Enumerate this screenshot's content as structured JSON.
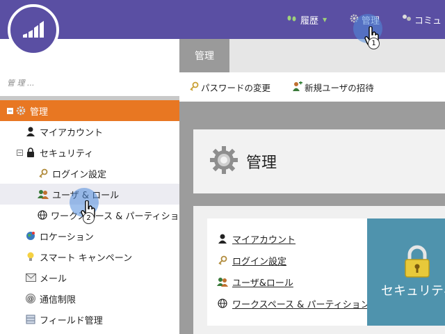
{
  "topbar": {
    "nav": [
      {
        "label": "履歴",
        "icon": "history-icon"
      },
      {
        "label": "管理",
        "icon": "gear-icon"
      },
      {
        "label": "コミュ",
        "icon": "community-icon"
      }
    ]
  },
  "sidebar": {
    "search_placeholder": "管 理 ...",
    "items": [
      {
        "label": "管理",
        "icon": "gear-icon"
      },
      {
        "label": "マイアカウント",
        "icon": "person-icon"
      },
      {
        "label": "セキュリティ",
        "icon": "lock-icon"
      },
      {
        "label": "ログイン設定",
        "icon": "key-icon"
      },
      {
        "label": "ユーザ & ロール",
        "icon": "users-icon"
      },
      {
        "label": "ワークスペース & パーティション",
        "icon": "globe-icon"
      },
      {
        "label": "ロケーション",
        "icon": "location-icon"
      },
      {
        "label": "スマート キャンペーン",
        "icon": "lightbulb-icon"
      },
      {
        "label": "メール",
        "icon": "mail-icon"
      },
      {
        "label": "通信制限",
        "icon": "at-sign-icon"
      },
      {
        "label": "フィールド管理",
        "icon": "database-icon"
      }
    ]
  },
  "main": {
    "tab_label": "管理",
    "toolbar": {
      "change_password": "パスワードの変更",
      "invite_user": "新規ユーザの招待"
    },
    "header_title": "管理",
    "links": [
      {
        "label": "マイアカウント"
      },
      {
        "label": "ログイン設定"
      },
      {
        "label": "ユーザ&ロール"
      },
      {
        "label": "ワークスペース & パーティション"
      }
    ],
    "security_tile_label": "セキュリティ"
  },
  "cursors": [
    {
      "step": "1"
    },
    {
      "step": "2"
    }
  ],
  "colors": {
    "topbar": "#5a4fa3",
    "selected": "#e87722",
    "tile": "#4f93ad"
  }
}
